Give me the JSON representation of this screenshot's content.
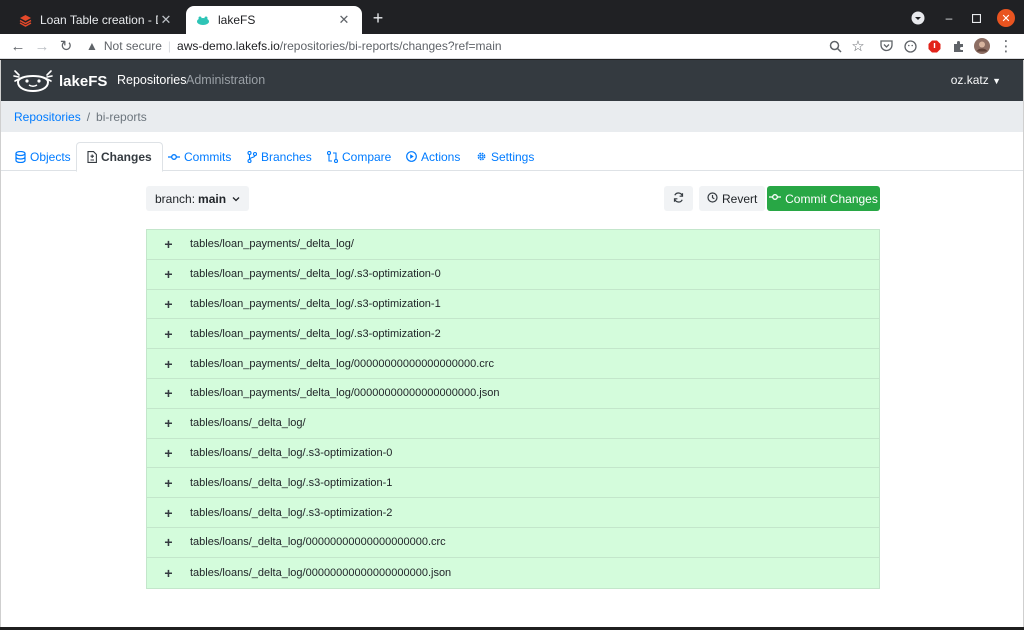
{
  "browser": {
    "tabs": [
      {
        "title": "Loan Table creation - Data",
        "active": false
      },
      {
        "title": "lakeFS",
        "active": true
      }
    ],
    "new_tab": "+",
    "address": {
      "security": "Not secure",
      "host": "aws-demo.lakefs.io",
      "path": "/repositories/bi-reports/changes?ref=main"
    }
  },
  "navbar": {
    "brand": "lakeFS",
    "links": [
      "Repositories",
      "Administration"
    ],
    "user": "oz.katz"
  },
  "breadcrumb": {
    "root": "Repositories",
    "separator": "/",
    "current": "bi-reports"
  },
  "repo_tabs": [
    "Objects",
    "Changes",
    "Commits",
    "Branches",
    "Compare",
    "Actions",
    "Settings"
  ],
  "active_tab": "Changes",
  "actions": {
    "branch_prefix": "branch:",
    "branch_name": "main",
    "revert_label": "Revert",
    "commit_label": "Commit Changes"
  },
  "changes": [
    "tables/loan_payments/_delta_log/",
    "tables/loan_payments/_delta_log/.s3-optimization-0",
    "tables/loan_payments/_delta_log/.s3-optimization-1",
    "tables/loan_payments/_delta_log/.s3-optimization-2",
    "tables/loan_payments/_delta_log/00000000000000000000.crc",
    "tables/loan_payments/_delta_log/00000000000000000000.json",
    "tables/loans/_delta_log/",
    "tables/loans/_delta_log/.s3-optimization-0",
    "tables/loans/_delta_log/.s3-optimization-1",
    "tables/loans/_delta_log/.s3-optimization-2",
    "tables/loans/_delta_log/00000000000000000000.crc",
    "tables/loans/_delta_log/00000000000000000000.json"
  ],
  "change_marker": "+",
  "colors": {
    "navbar": "#343a40",
    "link": "#007bff",
    "added_row": "#d4fcdc",
    "commit_button": "#28a745"
  }
}
